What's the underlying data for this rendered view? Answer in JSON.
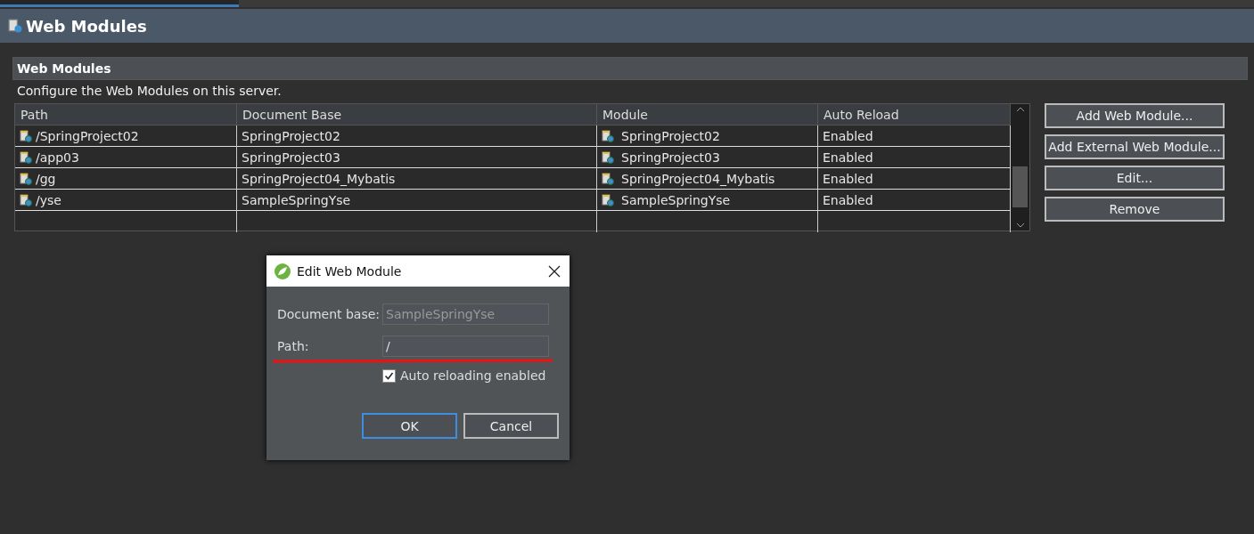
{
  "editor_tab": {
    "selected": true
  },
  "page": {
    "title": "Web Modules"
  },
  "section": {
    "title": "Web Modules",
    "description": "Configure the Web Modules on this server."
  },
  "table": {
    "columns": [
      "Path",
      "Document Base",
      "Module",
      "Auto Reload"
    ],
    "rows": [
      {
        "path": "/SpringProject02",
        "document_base": "SpringProject02",
        "module": "SpringProject02",
        "auto_reload": "Enabled"
      },
      {
        "path": "/app03",
        "document_base": "SpringProject03",
        "module": "SpringProject03",
        "auto_reload": "Enabled"
      },
      {
        "path": "/gg",
        "document_base": "SpringProject04_Mybatis",
        "module": "SpringProject04_Mybatis",
        "auto_reload": "Enabled"
      },
      {
        "path": "/yse",
        "document_base": "SampleSpringYse",
        "module": "SampleSpringYse",
        "auto_reload": "Enabled"
      }
    ]
  },
  "buttons": [
    "Add Web Module...",
    "Add External Web Module...",
    "Edit...",
    "Remove"
  ],
  "dialog": {
    "title": "Edit Web Module",
    "document_base_label": "Document base:",
    "document_base_value": "SampleSpringYse",
    "path_label": "Path:",
    "path_value": "/",
    "auto_reload": {
      "label": "Auto reloading enabled",
      "checked": true
    },
    "buttons": [
      {
        "label": "OK",
        "default": true
      },
      {
        "label": "Cancel",
        "default": false
      }
    ]
  }
}
